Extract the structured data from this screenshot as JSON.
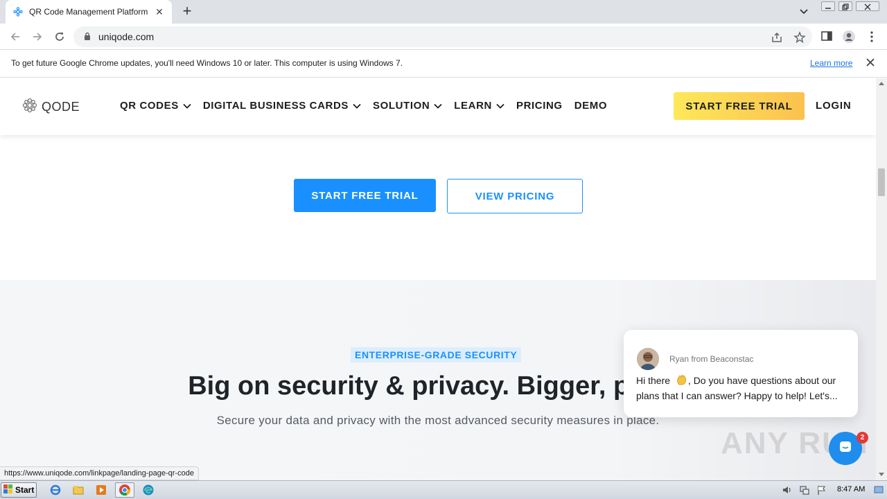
{
  "browser": {
    "tab_title": "QR Code Management Platform for m",
    "url": "uniqode.com",
    "infobar_text": "To get future Google Chrome updates, you'll need Windows 10 or later. This computer is using Windows 7.",
    "infobar_link": "Learn more",
    "status_url": "https://www.uniqode.com/linkpage/landing-page-qr-code"
  },
  "site": {
    "logo_text": "QODE",
    "nav": [
      {
        "label": "QR CODES",
        "dropdown": true
      },
      {
        "label": "DIGITAL BUSINESS CARDS",
        "dropdown": true
      },
      {
        "label": "SOLUTION",
        "dropdown": true
      },
      {
        "label": "LEARN",
        "dropdown": true
      },
      {
        "label": "PRICING",
        "dropdown": false
      },
      {
        "label": "DEMO",
        "dropdown": false
      }
    ],
    "nav_cta": "START FREE TRIAL",
    "nav_login": "LOGIN",
    "hero": {
      "primary_cta": "START FREE TRIAL",
      "secondary_cta": "VIEW PRICING"
    },
    "security": {
      "badge": "ENTERPRISE-GRADE SECURITY",
      "title": "Big on security & privacy. Bigger, peace",
      "subtitle": "Secure your data and privacy with the most advanced security measures in place."
    }
  },
  "chat": {
    "sender": "Ryan from Beaconstac",
    "message_part1": "Hi there",
    "message_part2": ",   Do you have questions about our plans that I can answer? Happy to help! Let's...",
    "unread_count": "2"
  },
  "watermark": "ANY RUN",
  "taskbar": {
    "start_label": "Start",
    "clock": "8:47 AM"
  },
  "colors": {
    "brand_blue": "#1a90ff",
    "cta_yellow": "#fde85a",
    "chat_blue": "#1f8ded"
  }
}
